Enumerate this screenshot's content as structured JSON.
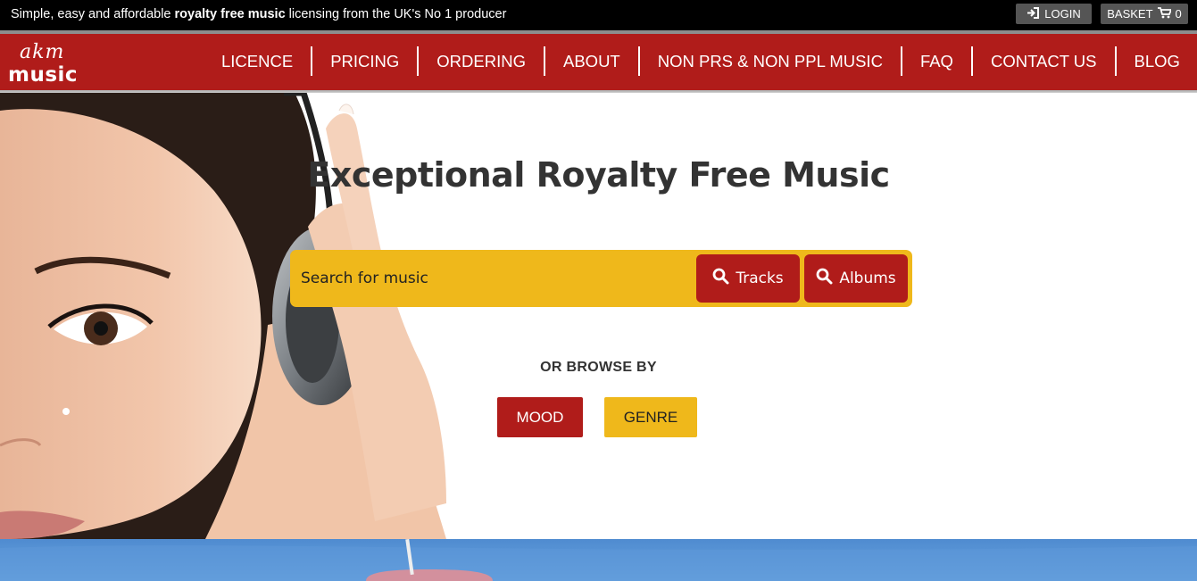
{
  "topbar": {
    "tagline_pre": "Simple, easy and affordable ",
    "tagline_bold": "royalty free music",
    "tagline_post": " licensing from the UK's No 1 producer",
    "login_label": "LOGIN",
    "login_icon": "sign-in-icon",
    "basket_label": "BASKET",
    "basket_icon": "cart-icon",
    "basket_count": "0"
  },
  "logo": {
    "top": "akm",
    "bottom": "music"
  },
  "nav": {
    "items": [
      {
        "label": "LICENCE"
      },
      {
        "label": "PRICING"
      },
      {
        "label": "ORDERING"
      },
      {
        "label": "ABOUT"
      },
      {
        "label": "NON PRS & NON PPL MUSIC"
      },
      {
        "label": "FAQ"
      },
      {
        "label": "CONTACT US"
      },
      {
        "label": "BLOG"
      }
    ]
  },
  "hero": {
    "title": "Exceptional Royalty Free Music",
    "search": {
      "placeholder": "Search for music",
      "tracks_label": "Tracks",
      "albums_label": "Albums"
    },
    "browse_label": "OR BROWSE BY",
    "mood_label": "MOOD",
    "genre_label": "GENRE"
  },
  "colors": {
    "brand_red": "#b01c1a",
    "accent_yellow": "#efb81b",
    "topbar_bg": "#000000"
  }
}
